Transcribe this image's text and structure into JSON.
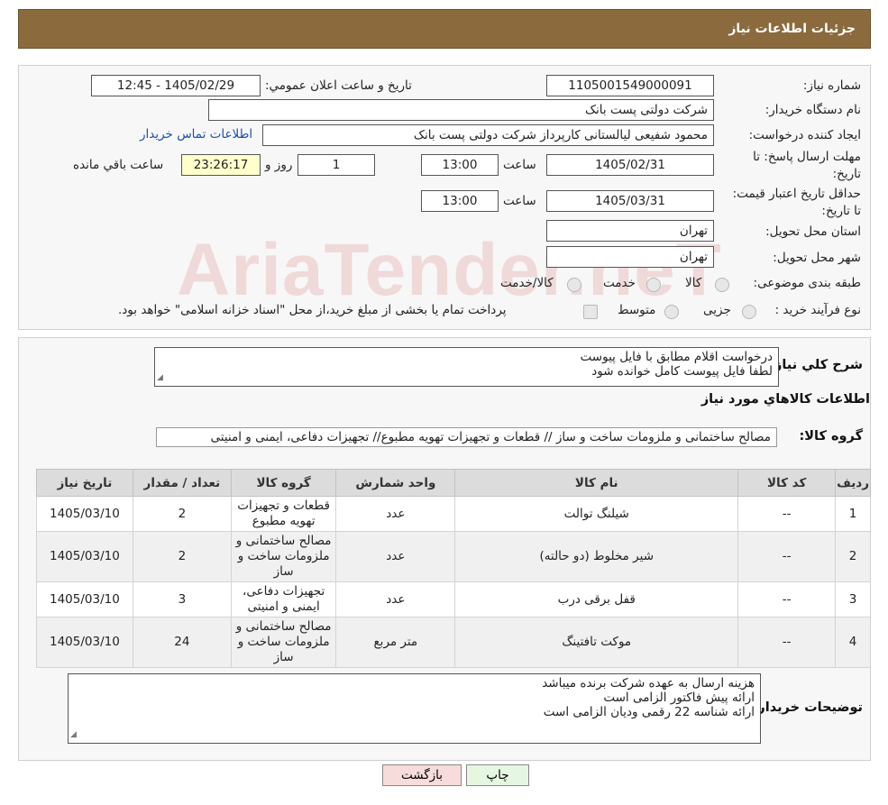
{
  "header": {
    "title": "جزئیات اطلاعات نیاز"
  },
  "form": {
    "need_number_label": "شماره نیاز:",
    "need_number": "1105001549000091",
    "announce_label": "تاریخ و ساعت اعلان عمومي:",
    "announce_value": "1405/02/29 - 12:45",
    "buyer_org_label": "نام دستگاه خريدار:",
    "buyer_org": "شرکت دولتی پست بانک",
    "creator_label": "ایجاد کننده درخواست:",
    "creator": "محمود شفیعی لیالستانی کارپرداز شرکت دولتی پست بانک",
    "contact_link": "اطلاعات تماس خریدار",
    "deadline_label": "مهلت ارسال پاسخ: تا تاریخ:",
    "deadline_date": "1405/02/31",
    "time_label": "ساعت",
    "deadline_time": "13:00",
    "days_value": "1",
    "days_label": "روز و",
    "remaining_time": "23:26:17",
    "remaining_label": "ساعت باقي مانده",
    "validity_label": "حداقل تاريخ اعتبار قيمت: تا تاریخ:",
    "validity_date": "1405/03/31",
    "validity_time": "13:00",
    "province_label": "استان محل تحویل:",
    "province": "تهران",
    "city_label": "شهر محل تحویل:",
    "city": "تهران",
    "category_label": "طبقه بندی موضوعی:",
    "category_options": [
      "کالا",
      "خدمت",
      "کالا/خدمت"
    ],
    "process_label": "نوع فرآیند خرید :",
    "process_options": [
      "جزیی",
      "متوسط"
    ],
    "process_note": "پرداخت تمام یا بخشی از مبلغ خرید،از محل \"اسناد خزانه اسلامی\" خواهد بود."
  },
  "details": {
    "summary_label": "شرح كلي نياز:",
    "summary_lines": [
      "درخواست اقلام مطابق با فایل پیوست",
      "لطفا فایل پیوست کامل خوانده شود"
    ],
    "items_heading": "اطلاعات كالاهاي مورد نياز",
    "group_label": "گروه كالا:",
    "group_value": "مصالح ساختمانی و ملزومات ساخت و ساز //  قطعات و تجهیزات تهویه مطبوع// تجهیزات دفاعی، ایمنی و امنیتی",
    "table": {
      "headers": [
        "رديف",
        "كد كالا",
        "نام كالا",
        "واحد شمارش",
        "گروه كالا",
        "تعداد / مقدار",
        "تاريخ نياز"
      ],
      "rows": [
        [
          "1",
          "--",
          "شیلنگ توالت",
          "عدد",
          "قطعات و تجهیزات تهویه مطبوع",
          "2",
          "1405/03/10"
        ],
        [
          "2",
          "--",
          "شیر مخلوط (دو حالته)",
          "عدد",
          "مصالح ساختمانی و ملزومات ساخت و ساز",
          "2",
          "1405/03/10"
        ],
        [
          "3",
          "--",
          "قفل برقی درب",
          "عدد",
          "تجهیزات دفاعی، ایمنی و امنیتی",
          "3",
          "1405/03/10"
        ],
        [
          "4",
          "--",
          "موکت تافتینگ",
          "متر مربع",
          "مصالح ساختمانی و ملزومات ساخت و ساز",
          "24",
          "1405/03/10"
        ]
      ]
    },
    "buyer_notes_label": "توضیحات خریدار:",
    "buyer_notes_lines": [
      "هزینه ارسال به عهده شرکت برنده میباشد",
      "ارائه پیش فاکتور الزامی است",
      "ارائه شناسه 22 رقمی ودیان الزامی است"
    ]
  },
  "buttons": {
    "print": "چاپ",
    "back": "بازگشت"
  },
  "watermark": "AriaTender.neT",
  "colors": {
    "header_bg": "#8b6a3e",
    "back_button_bg": "#f7dcdc",
    "print_button_bg": "#e6f7e1"
  }
}
